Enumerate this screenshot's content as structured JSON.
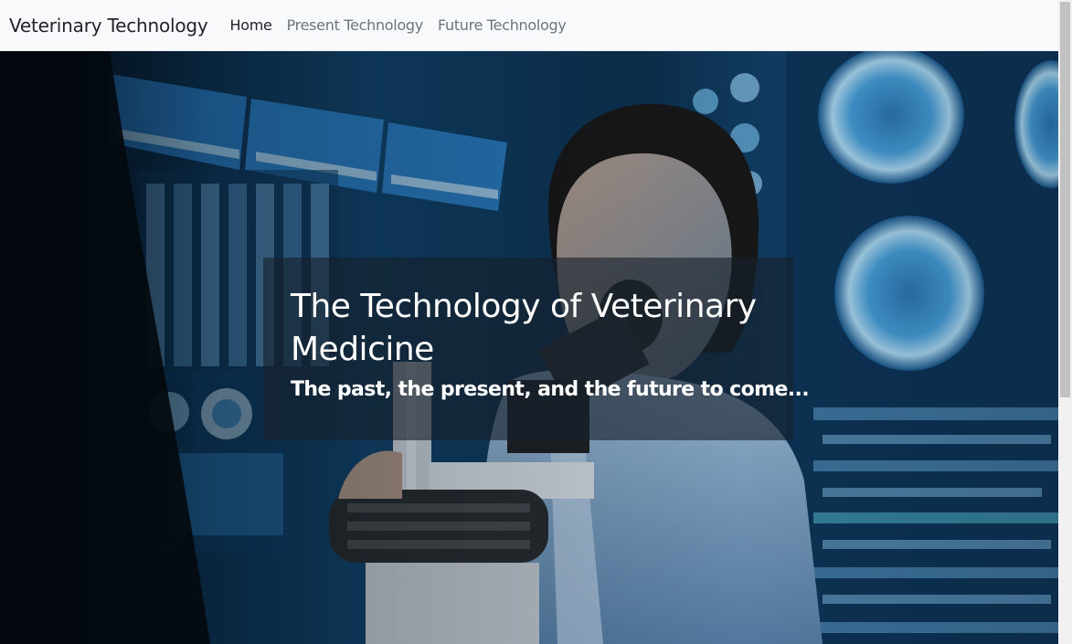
{
  "navbar": {
    "brand": "Veterinary Technology",
    "links": [
      {
        "label": "Home",
        "active": true
      },
      {
        "label": "Present Technology",
        "active": false
      },
      {
        "label": "Future Technology",
        "active": false
      }
    ]
  },
  "hero": {
    "title": "The Technology of Veterinary Medicine",
    "subtitle": "The past, the present, and the future to come..."
  },
  "colors": {
    "navbar_bg": "#f8f9fa",
    "nav_active": "#212529",
    "nav_inactive": "#6c757d",
    "hero_text": "#ffffff"
  },
  "icons": {
    "hero_image": "scientist-microscope-lab-photo"
  }
}
